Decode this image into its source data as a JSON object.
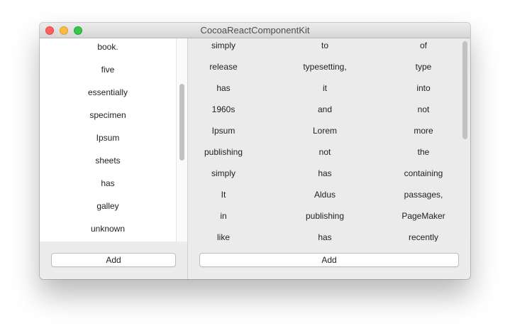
{
  "window": {
    "title": "CocoaReactComponentKit"
  },
  "left_list": {
    "items": [
      "book.",
      "five",
      "essentially",
      "specimen",
      "Ipsum",
      "sheets",
      "has",
      "galley",
      "unknown"
    ],
    "add_label": "Add"
  },
  "right_grid": {
    "rows": [
      [
        "simply",
        "to",
        "of"
      ],
      [
        "release",
        "typesetting,",
        "type"
      ],
      [
        "has",
        "it",
        "into"
      ],
      [
        "1960s",
        "and",
        "not"
      ],
      [
        "Ipsum",
        "Lorem",
        "more"
      ],
      [
        "publishing",
        "not",
        "the"
      ],
      [
        "simply",
        "has",
        "containing"
      ],
      [
        "It",
        "Aldus",
        "passages,"
      ],
      [
        "in",
        "publishing",
        "PageMaker"
      ],
      [
        "like",
        "has",
        "recently"
      ]
    ],
    "add_label": "Add"
  },
  "colors": {
    "close": "#fc605c",
    "minimize": "#fdbc40",
    "maximize": "#34c84a"
  }
}
